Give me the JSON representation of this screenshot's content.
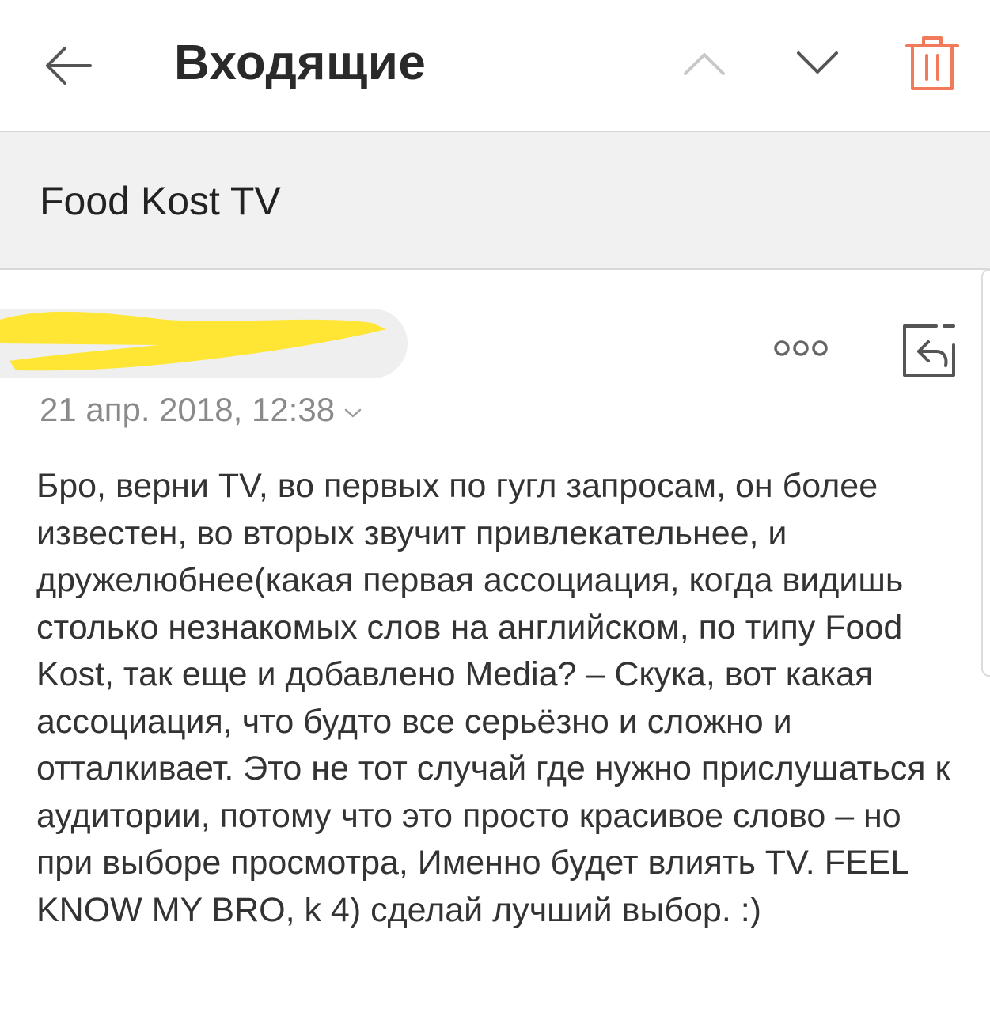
{
  "toolbar": {
    "title": "Входящие",
    "back_icon": "arrow-left-icon",
    "prev_icon": "chevron-up-icon",
    "next_icon": "chevron-down-icon",
    "delete_icon": "trash-icon",
    "delete_color": "#f07a5a"
  },
  "message": {
    "subject": "Food Kost TV",
    "sender_redacted": true,
    "redaction_color": "#ffe634",
    "date": "21 апр. 2018, 12:38",
    "more_icon": "more-dots-icon",
    "reply_icon": "reply-icon",
    "body": "Бро, верни TV, во первых по гугл запросам, он более известен, во вторых звучит привлекательнее, и дружелюбнее(какая первая ассоциация, когда видишь столько незнакомых слов на английском, по типу Food Kost, так еще и добавлено Media? – Скука, вот какая ассоциация, что будто все серьёзно и сложно и отталкивает. Это не тот случай где нужно прислушаться к аудитории, потому что это просто красивое слово – но при выборе просмотра, Именно будет влиять TV. FEEL KNOW MY BRO, k 4) сделай лучший выбор. :)"
  }
}
